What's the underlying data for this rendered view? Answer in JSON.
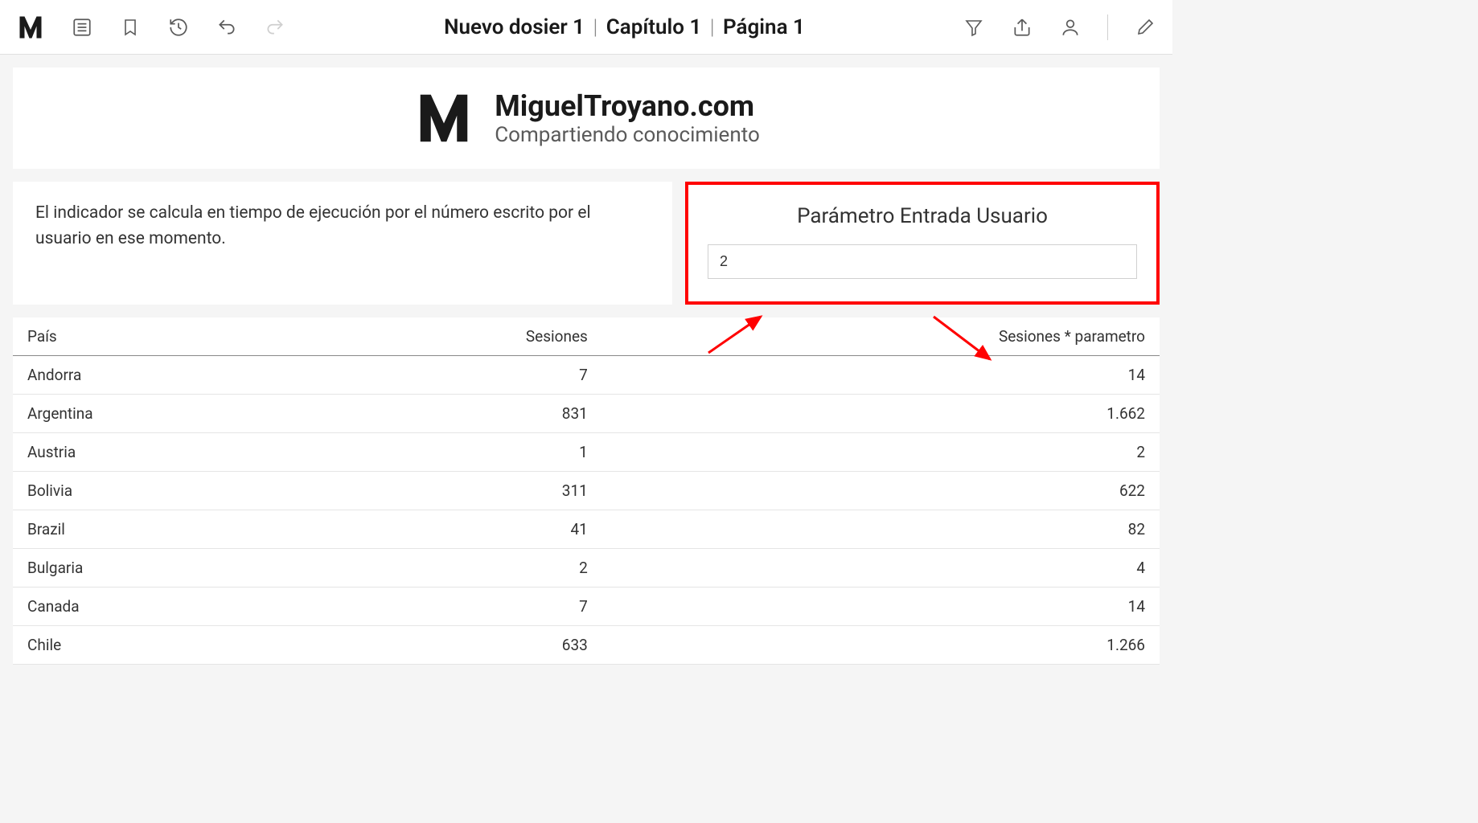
{
  "breadcrumb": {
    "dossier": "Nuevo dosier 1",
    "chapter": "Capítulo 1",
    "page": "Página 1"
  },
  "banner": {
    "title": "MiguelTroyano.com",
    "subtitle": "Compartiendo conocimiento"
  },
  "description": "El indicador se calcula en tiempo de ejecución por el número escrito por el usuario en ese momento.",
  "param": {
    "title": "Parámetro Entrada Usuario",
    "value": "2"
  },
  "table": {
    "columns": {
      "country": "País",
      "sessions": "Sesiones",
      "sessions_param": "Sesiones * parametro"
    },
    "rows": [
      {
        "country": "Andorra",
        "sessions": "7",
        "sessions_param": "14"
      },
      {
        "country": "Argentina",
        "sessions": "831",
        "sessions_param": "1.662"
      },
      {
        "country": "Austria",
        "sessions": "1",
        "sessions_param": "2"
      },
      {
        "country": "Bolivia",
        "sessions": "311",
        "sessions_param": "622"
      },
      {
        "country": "Brazil",
        "sessions": "41",
        "sessions_param": "82"
      },
      {
        "country": "Bulgaria",
        "sessions": "2",
        "sessions_param": "4"
      },
      {
        "country": "Canada",
        "sessions": "7",
        "sessions_param": "14"
      },
      {
        "country": "Chile",
        "sessions": "633",
        "sessions_param": "1.266"
      }
    ]
  },
  "colors": {
    "highlight_border": "#ff0000",
    "arrow": "#ff0000"
  }
}
